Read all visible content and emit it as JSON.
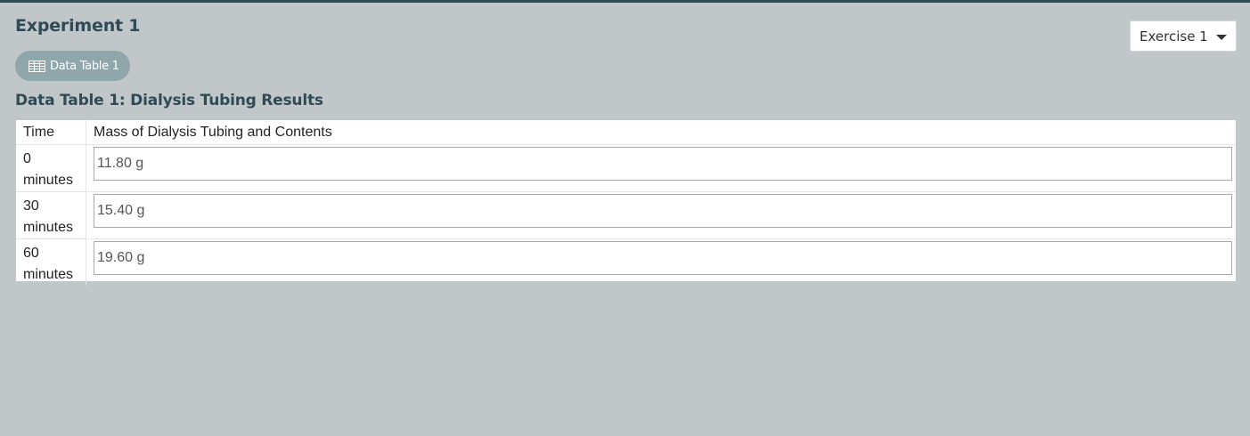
{
  "page": {
    "title": "Experiment 1"
  },
  "exercise_select": {
    "selected": "Exercise 1"
  },
  "tabs": [
    {
      "label": "Data Table 1",
      "icon": "table-icon"
    }
  ],
  "section": {
    "title": "Data Table 1: Dialysis Tubing Results"
  },
  "table": {
    "headers": [
      "Time",
      "Mass of Dialysis Tubing and Contents"
    ],
    "rows": [
      {
        "time": "0 minutes",
        "mass": "11.80 g"
      },
      {
        "time": "30 minutes",
        "mass": "15.40 g"
      },
      {
        "time": "60 minutes",
        "mass": "19.60 g"
      }
    ]
  },
  "colors": {
    "background": "#c1c6c8",
    "top_bar": "#2e4a52",
    "heading": "#2f4b55",
    "pill": "#8fa6ab"
  }
}
